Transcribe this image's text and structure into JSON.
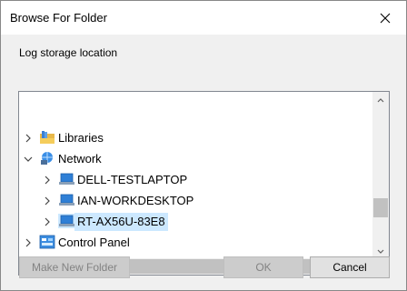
{
  "dialog": {
    "title": "Browse For Folder",
    "description": "Log storage location"
  },
  "tree": {
    "items": [
      {
        "label": "Libraries",
        "icon": "libraries-icon",
        "expanded": false,
        "level": 0
      },
      {
        "label": "Network",
        "icon": "network-icon",
        "expanded": true,
        "level": 0
      },
      {
        "label": "DELL-TESTLAPTOP",
        "icon": "computer-icon",
        "expanded": false,
        "level": 1
      },
      {
        "label": "IAN-WORKDESKTOP",
        "icon": "computer-icon",
        "expanded": false,
        "level": 1
      },
      {
        "label": "RT-AX56U-83E8",
        "icon": "computer-icon",
        "expanded": false,
        "level": 1,
        "selected": true
      },
      {
        "label": "Control Panel",
        "icon": "control-panel-icon",
        "expanded": false,
        "level": 0
      }
    ]
  },
  "buttons": {
    "make_new_folder": "Make New Folder",
    "ok": "OK",
    "cancel": "Cancel"
  },
  "colors": {
    "selection": "#cce8ff",
    "dialog_bg": "#f0f0f0"
  }
}
